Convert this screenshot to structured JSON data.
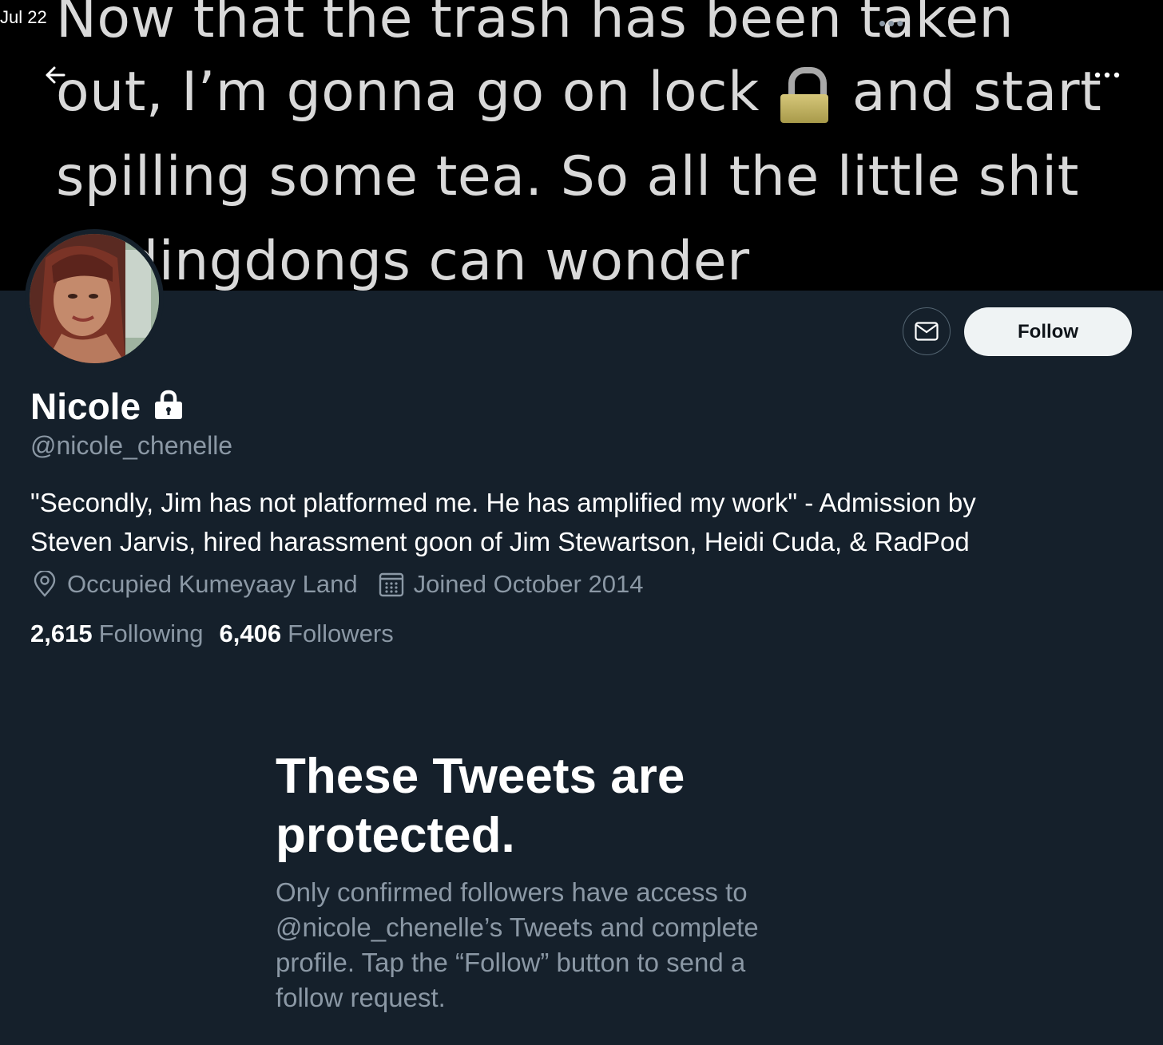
{
  "status_bar": {
    "time": "Jul 22",
    "dots": "•••"
  },
  "banner": {
    "line1": "Now that the trash has been taken",
    "line2a": "out, I’m gonna go on lock",
    "line2b": "and start",
    "line3": "spilling some tea. So all the little shit",
    "line4": "in dingdongs can wonder"
  },
  "header": {
    "back_icon": "arrow-left-icon",
    "more_icon": "more-horizontal-icon",
    "more_label": "•••"
  },
  "profile": {
    "name": "Nicole",
    "handle": "@nicole_chenelle",
    "bio_line1": "\"Secondly, Jim has not platformed me. He has amplified my work\" - Admission by",
    "bio_line2": "Steven Jarvis, hired harassment goon of Jim Stewartson, Heidi Cuda, & RadPod",
    "location": "Occupied Kumeyaay Land",
    "joined": "Joined October 2014",
    "following_count": "2,615",
    "following_label": "Following",
    "followers_count": "6,406",
    "followers_label": "Followers"
  },
  "actions": {
    "message_icon": "envelope-icon",
    "follow_label": "Follow"
  },
  "protected": {
    "title_line1": "These Tweets are",
    "title_line2": "protected.",
    "desc_line1": "Only confirmed followers have access to",
    "desc_line2": "@nicole_chenelle’s Tweets and complete",
    "desc_line3": "profile. Tap the “Follow” button to send a",
    "desc_line4": "follow request."
  },
  "colors": {
    "background": "#15202b",
    "banner": "#000000",
    "secondary_text": "#8b98a5",
    "follow_button_bg": "#eff3f4"
  }
}
